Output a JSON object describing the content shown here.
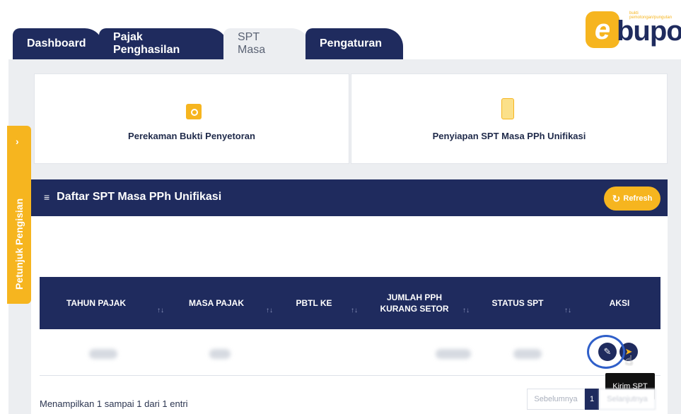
{
  "tabs": [
    {
      "label": "Dashboard"
    },
    {
      "label": "Pajak Penghasilan"
    },
    {
      "label": "SPT Masa"
    },
    {
      "label": "Pengaturan"
    }
  ],
  "logo": {
    "letter": "e",
    "text": "bupot",
    "small": "bukti pemotongan/pungutan"
  },
  "side_tab": {
    "label": "Petunjuk Pengisian",
    "arrow": "›"
  },
  "cards": [
    {
      "label": "Perekaman Bukti Penyetoran",
      "icon": "camera-icon"
    },
    {
      "label": "Penyiapan SPT Masa PPh Unifikasi",
      "icon": "document-icon"
    }
  ],
  "panel": {
    "title": "Daftar SPT Masa PPh Unifikasi",
    "list_icon": "≡",
    "refresh_label": "Refresh",
    "refresh_icon": "↻"
  },
  "table": {
    "columns": [
      {
        "label": "TAHUN PAJAK"
      },
      {
        "label": "MASA PAJAK"
      },
      {
        "label": "PBTL KE"
      },
      {
        "label": "JUMLAH PPH\nKURANG SETOR"
      },
      {
        "label": "STATUS SPT"
      },
      {
        "label": "AKSI"
      }
    ],
    "sort_icon": "↑↓",
    "actions": {
      "edit_icon": "✎",
      "send_icon": "➤"
    }
  },
  "tooltip": "Kirim SPT",
  "footer": {
    "info": "Menampilkan 1 sampai 1 dari 1 entri",
    "prev": "Sebelumnya",
    "page": "1",
    "next": "Selanjutnya"
  },
  "colors": {
    "navy": "#1f2b5e",
    "accent": "#f6b51f",
    "highlight": "#2f5fc9"
  }
}
